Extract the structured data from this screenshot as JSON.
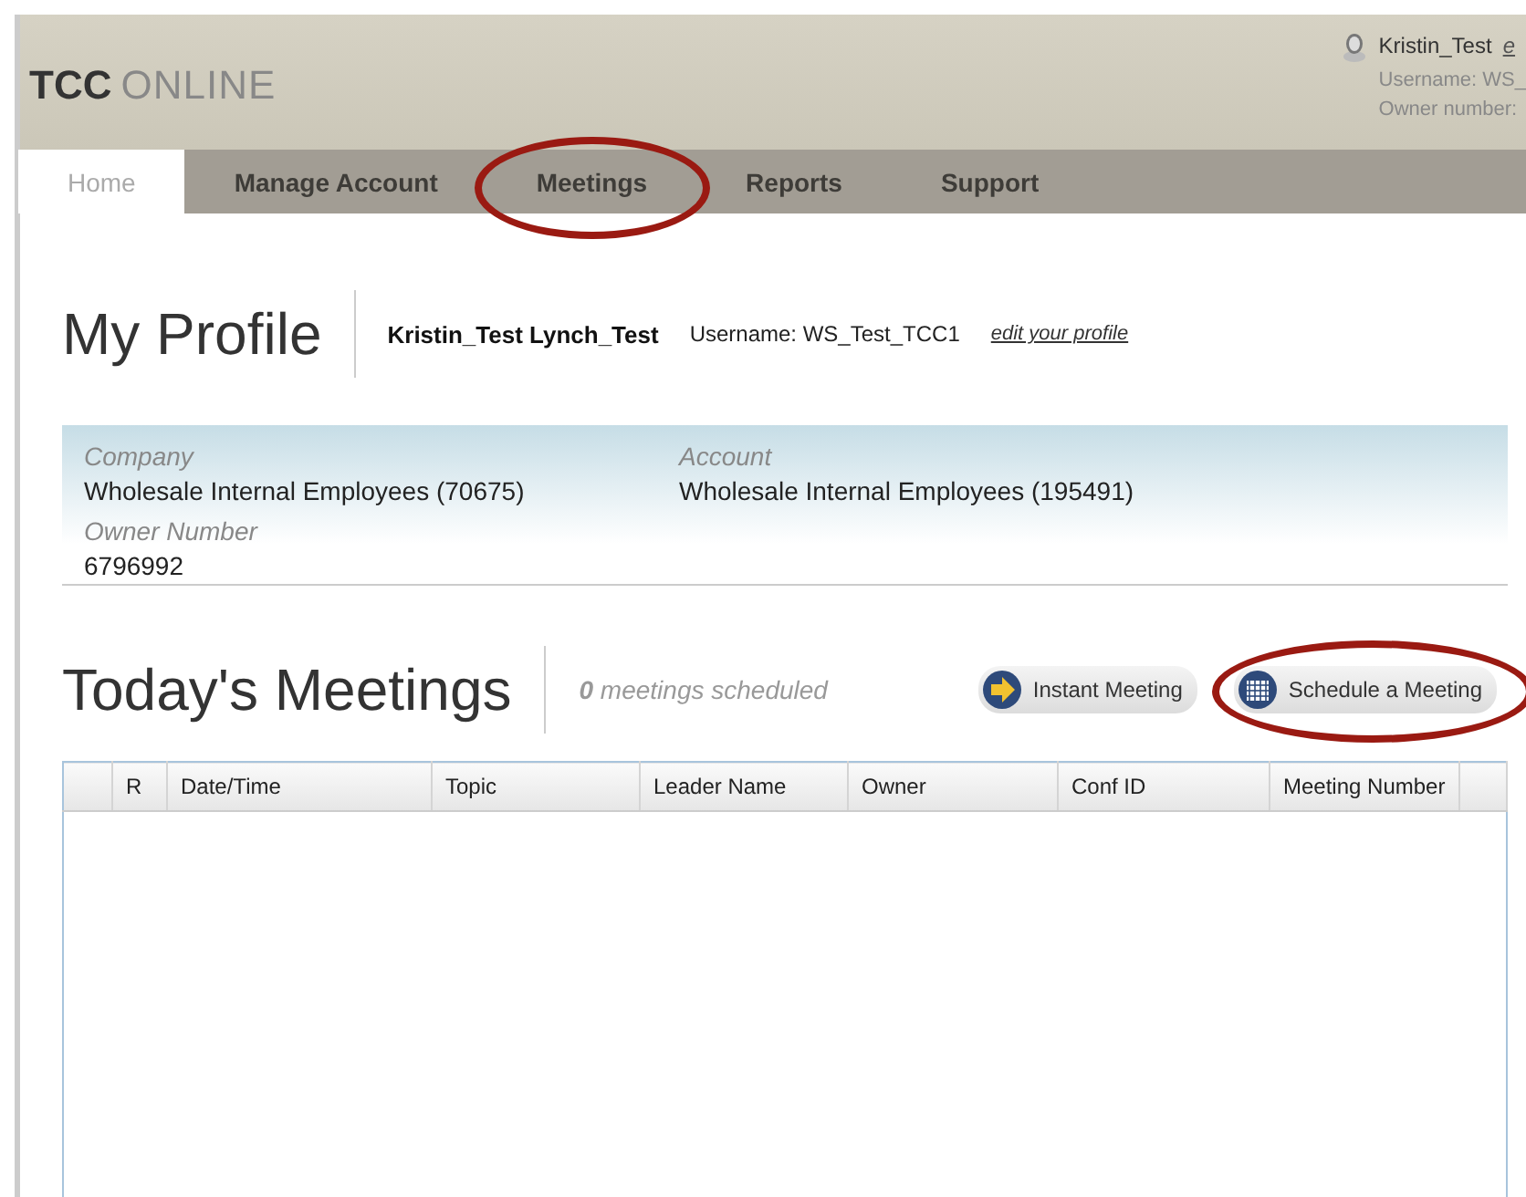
{
  "header": {
    "logo_bold": "TCC",
    "logo_light": "ONLINE",
    "user": {
      "name": "Kristin_Test",
      "link": "e",
      "username": "Username: WS_",
      "owner": "Owner number:"
    }
  },
  "nav": [
    {
      "label": "Home",
      "selected": true,
      "circled": false
    },
    {
      "label": "Manage Account",
      "selected": false,
      "circled": false
    },
    {
      "label": "Meetings",
      "selected": false,
      "circled": true
    },
    {
      "label": "Reports",
      "selected": false,
      "circled": false
    },
    {
      "label": "Support",
      "selected": false,
      "circled": false
    }
  ],
  "profile": {
    "title": "My Profile",
    "full_name": "Kristin_Test Lynch_Test",
    "username": "Username: WS_Test_TCC1",
    "edit_link": "edit your profile",
    "fields": [
      {
        "label": "Company",
        "value": "Wholesale Internal Employees (70675)"
      },
      {
        "label": "Account",
        "value": "Wholesale Internal Employees (195491)"
      },
      {
        "label": "Owner Number",
        "value": "6796992"
      }
    ]
  },
  "meetings": {
    "title": "Today's Meetings",
    "count": "**0** meetings scheduled",
    "buttons": [
      {
        "label": "Instant Meeting",
        "kind": "instant",
        "circled": false
      },
      {
        "label": "Schedule a Meeting",
        "kind": "schedule",
        "circled": true
      }
    ],
    "table": {
      "columns": [
        "",
        "R",
        "Date/Time",
        "Topic",
        "Leader Name",
        "Owner",
        "Conf ID",
        "Meeting Number",
        ""
      ]
    }
  }
}
